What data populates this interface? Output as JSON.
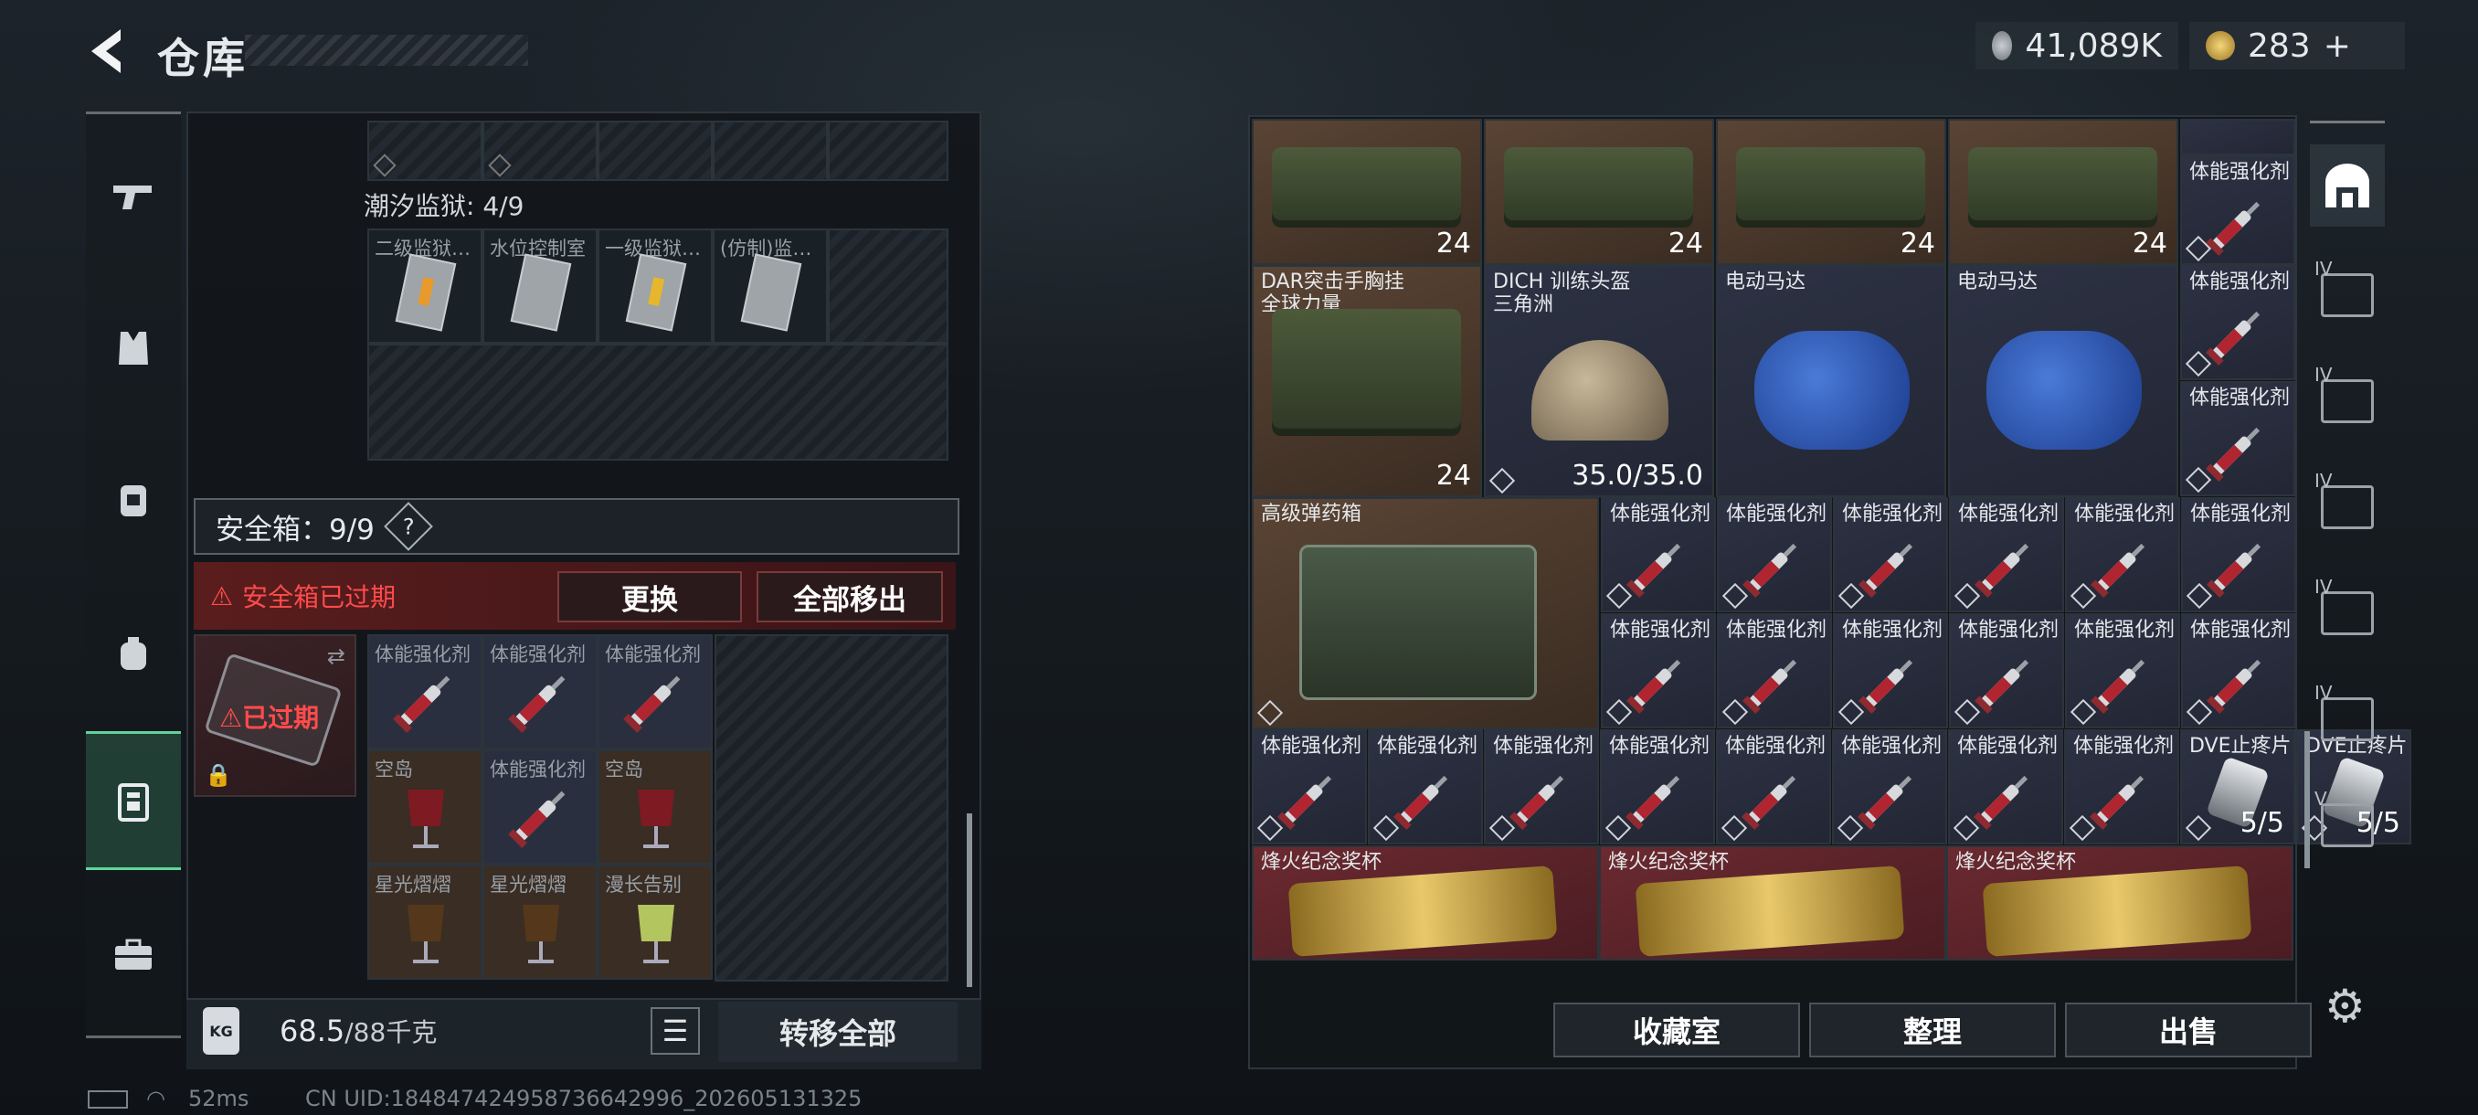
{
  "header": {
    "title": "仓库",
    "currency_1": "41,089K",
    "currency_2": "283",
    "currency_2_plus": "+"
  },
  "left_panel": {
    "prison_label": "潮汐监狱: 4/9",
    "keys": [
      "二级监狱…",
      "水位控制室",
      "一级监狱…",
      "(仿制)监…"
    ],
    "secure_label": "安全箱：9/9",
    "help": "?",
    "expired_text": "安全箱已过期",
    "replace_btn": "更换",
    "move_all_out_btn": "全部移出",
    "case_status": "已过期",
    "items": [
      {
        "label": "体能强化剂",
        "type": "syringe"
      },
      {
        "label": "体能强化剂",
        "type": "syringe"
      },
      {
        "label": "体能强化剂",
        "type": "syringe"
      },
      {
        "label": "空岛",
        "type": "cocktail"
      },
      {
        "label": "体能强化剂",
        "type": "syringe"
      },
      {
        "label": "空岛",
        "type": "cocktail"
      },
      {
        "label": "星光熠熠",
        "type": "drink"
      },
      {
        "label": "星光熠熠",
        "type": "drink"
      },
      {
        "label": "漫长告别",
        "type": "martini"
      }
    ],
    "weight": "68.5",
    "weight_max": "/88千克",
    "transfer_all": "转移全部"
  },
  "right_panel": {
    "bag_count": "24",
    "chest_rig_name": "DAR突击手胸挂\n全球力量",
    "helmet_name": "DICH 训练头盔\n三角洲",
    "helmet_durability": "35.0/35.0",
    "motor_name": "电动马达",
    "ammo_box_name": "高级弹药箱",
    "syringe_name": "体能强化剂",
    "painkiller_name": "DVE止疼片",
    "painkiller_count": "5/5",
    "trophy_name": "烽火纪念奖杯",
    "buttons": {
      "collection": "收藏室",
      "sort": "整理",
      "sell": "出售"
    }
  },
  "right_rail": {
    "tabs": [
      "IV",
      "IV",
      "IV",
      "IV",
      "IV",
      "V"
    ]
  },
  "status": {
    "ping": "52ms",
    "uid": "CN UID:184847424958736642996_202605131325"
  },
  "colors": {
    "accent_green": "#5fd49a",
    "danger_red": "#ff4b4b",
    "gold": "#d9b24a"
  }
}
